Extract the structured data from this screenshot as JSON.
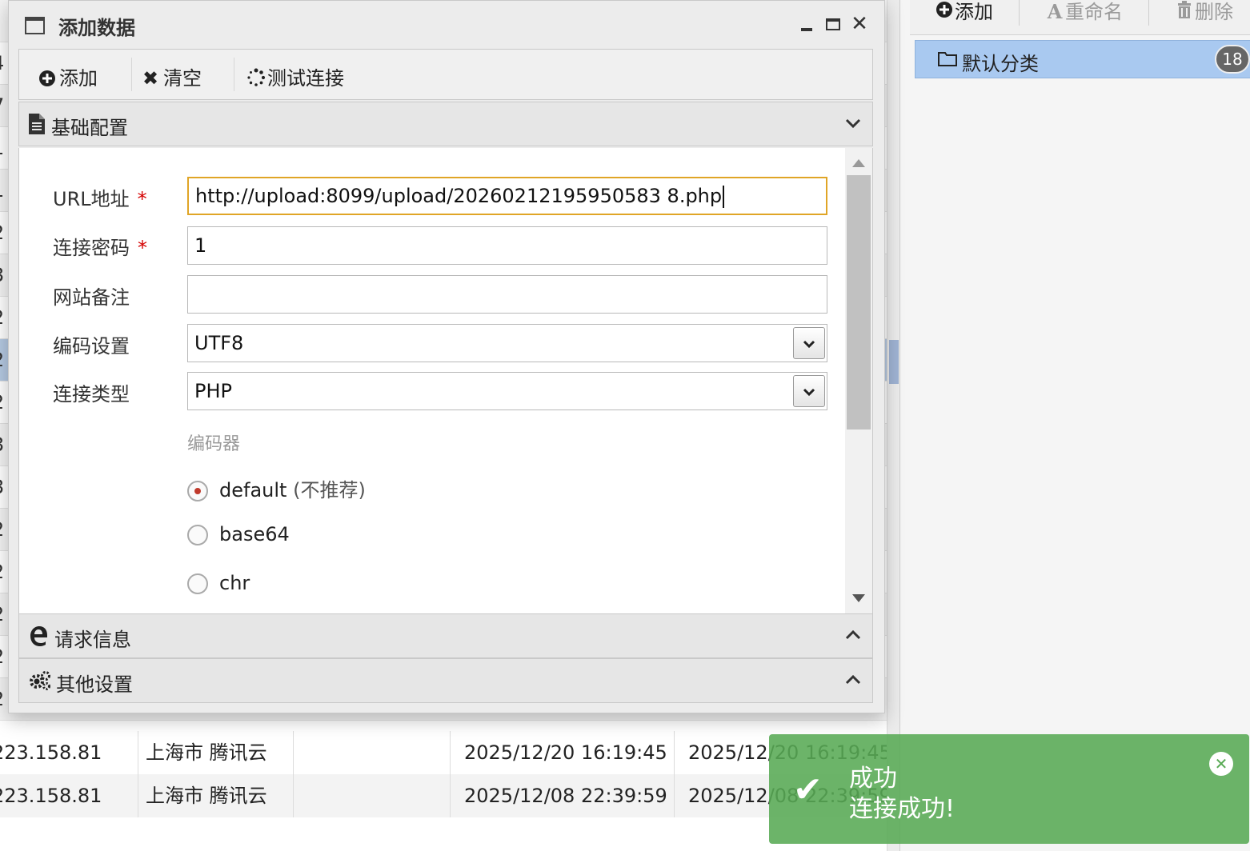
{
  "background_table": {
    "stub_digits": [
      "4",
      "7",
      "1",
      "1",
      "2",
      "3",
      "2",
      "2",
      "2",
      "3",
      "3",
      "2",
      "2",
      "2",
      "2",
      "2",
      "2"
    ],
    "rows": [
      {
        "ip": "223.158.81",
        "location": "上海市 腾讯云",
        "created": "2025/12/20 16:19:45",
        "updated": "2025/12/20 16:19:45"
      },
      {
        "ip": "223.158.81",
        "location": "上海市 腾讯云",
        "created": "2025/12/08 22:39:59",
        "updated": "2025/12/08 22:39:59"
      }
    ]
  },
  "right_panel": {
    "toolbar": {
      "add_label": "添加",
      "rename_label": "重命名",
      "delete_label": "删除"
    },
    "category": {
      "label": "默认分类",
      "count": "18"
    }
  },
  "dialog": {
    "title": "添加数据",
    "toolbar": {
      "add_label": "添加",
      "clear_label": "清空",
      "test_label": "测试连接"
    },
    "sections": {
      "basic": "基础配置",
      "request": "请求信息",
      "other": "其他设置"
    },
    "form": {
      "url_label": "URL地址",
      "url_value": "http://upload:8099/upload/20260212195950583 8.php",
      "password_label": "连接密码",
      "password_value": "1",
      "note_label": "网站备注",
      "note_value": "",
      "encoding_label": "编码设置",
      "encoding_value": "UTF8",
      "type_label": "连接类型",
      "type_value": "PHP",
      "required_mark": "*",
      "encoder_title": "编码器",
      "encoders": [
        {
          "name": "default",
          "note": "(不推荐)",
          "checked": true
        },
        {
          "name": "base64",
          "note": "",
          "checked": false
        },
        {
          "name": "chr",
          "note": "",
          "checked": false
        }
      ]
    }
  },
  "toast": {
    "title": "成功",
    "message": "连接成功!",
    "color": "#58aa54"
  }
}
